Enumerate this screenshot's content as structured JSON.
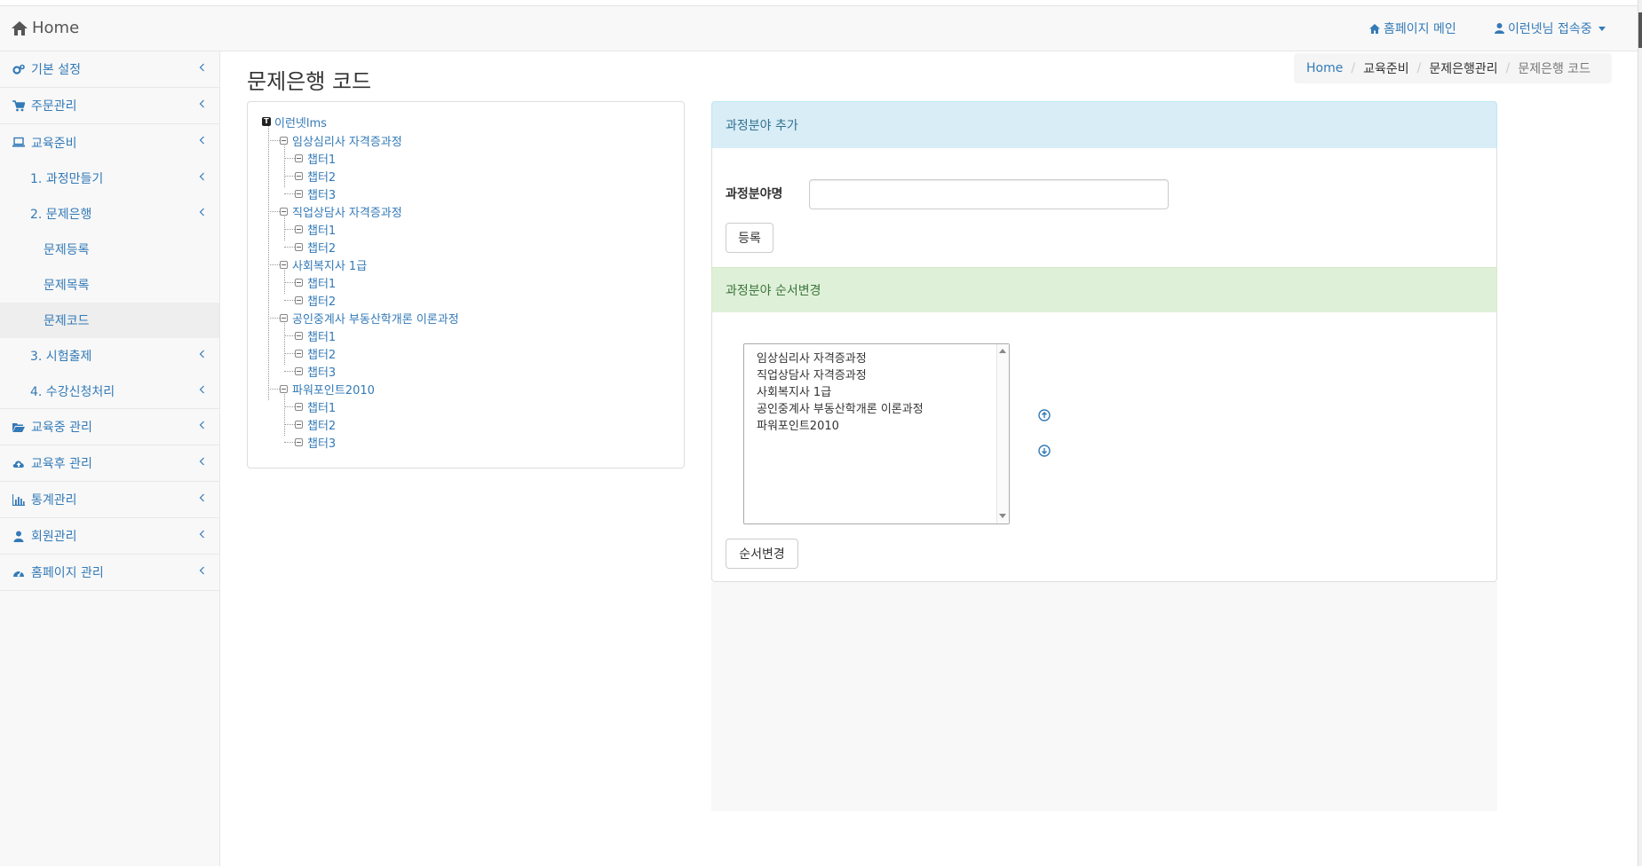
{
  "navbar": {
    "brand": "Home",
    "homepage_link": "홈페이지 메인",
    "user_menu": "이런넷님 접속중"
  },
  "sidebar": {
    "items": [
      {
        "label": "기본 설정",
        "icon": "cogs-icon"
      },
      {
        "label": "주문관리",
        "icon": "cart-icon"
      },
      {
        "label": "교육준비",
        "icon": "laptop-icon"
      },
      {
        "label": "1. 과정만들기"
      },
      {
        "label": "2. 문제은행"
      },
      {
        "label": "문제등록"
      },
      {
        "label": "문제목록"
      },
      {
        "label": "문제코드"
      },
      {
        "label": "3. 시험출제"
      },
      {
        "label": "4. 수강신청처리"
      },
      {
        "label": "교육중 관리",
        "icon": "folder-open-icon"
      },
      {
        "label": "교육후 관리",
        "icon": "cloud-upload-icon"
      },
      {
        "label": "통계관리",
        "icon": "bar-chart-icon"
      },
      {
        "label": "회원관리",
        "icon": "user-icon"
      },
      {
        "label": "홈페이지 관리",
        "icon": "dashboard-icon"
      }
    ]
  },
  "page": {
    "title": "문제은행 코드"
  },
  "breadcrumb": {
    "items": [
      "Home",
      "교육준비",
      "문제은행관리",
      "문제은행 코드"
    ]
  },
  "tree": {
    "root": "이런넷lms",
    "courses": [
      {
        "name": "임상심리사 자격증과정",
        "chapters": [
          "챕터1",
          "챕터2",
          "챕터3"
        ]
      },
      {
        "name": "직업상담사 자격증과정",
        "chapters": [
          "챕터1",
          "챕터2"
        ]
      },
      {
        "name": "사회복지사 1급",
        "chapters": [
          "챕터1",
          "챕터2"
        ]
      },
      {
        "name": "공인중계사 부동산학개론 이론과정",
        "chapters": [
          "챕터1",
          "챕터2",
          "챕터3"
        ]
      },
      {
        "name": "파워포인트2010",
        "chapters": [
          "챕터1",
          "챕터2",
          "챕터3"
        ]
      }
    ]
  },
  "add_panel": {
    "heading": "과정분야 추가",
    "field_label": "과정분야명",
    "field_value": "",
    "field_placeholder": "",
    "submit_label": "등록"
  },
  "order_panel": {
    "heading": "과정분야 순서변경",
    "options": [
      "임상심리사 자격증과정",
      "직업상담사 자격증과정",
      "사회복지사 1급",
      "공인중계사 부동산학개론 이론과정",
      "파워포인트2010"
    ],
    "submit_label": "순서변경"
  },
  "colors": {
    "link": "#337ab7",
    "info_bg": "#d9edf7",
    "info_text": "#31708f",
    "success_bg": "#dff0d8",
    "success_text": "#3c763d"
  }
}
